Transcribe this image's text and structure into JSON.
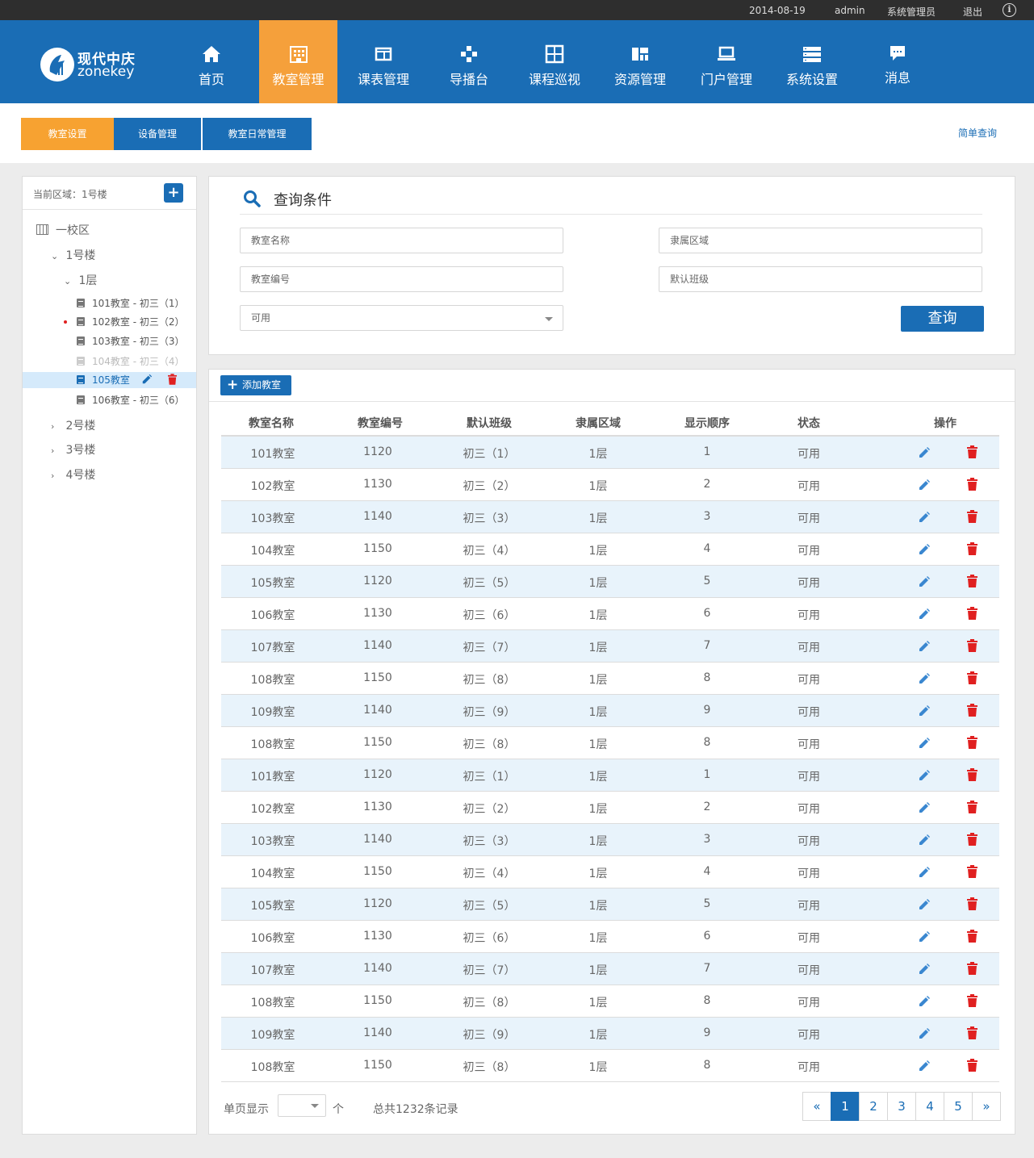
{
  "topbar": {
    "date": "2014-08-19",
    "user": "admin",
    "role": "系统管理员",
    "logout": "退出",
    "info_icon": "info-icon"
  },
  "brand": {
    "cn": "现代中庆",
    "en": "zonekey"
  },
  "colors": {
    "primary": "#1a6db5",
    "accent": "#f5a03b",
    "danger": "#e02020",
    "row_alt": "#e8f3fb"
  },
  "nav": [
    {
      "label": "首页",
      "icon": "home-icon",
      "active": false
    },
    {
      "label": "教室管理",
      "icon": "building-icon",
      "active": true
    },
    {
      "label": "课表管理",
      "icon": "schedule-icon",
      "active": false
    },
    {
      "label": "导播台",
      "icon": "gamepad-icon",
      "active": false
    },
    {
      "label": "课程巡视",
      "icon": "grid-icon",
      "active": false
    },
    {
      "label": "资源管理",
      "icon": "dashboard-icon",
      "active": false
    },
    {
      "label": "门户管理",
      "icon": "laptop-icon",
      "active": false
    },
    {
      "label": "系统设置",
      "icon": "list-icon",
      "active": false
    },
    {
      "label": "消息",
      "icon": "message-icon",
      "active": false
    }
  ],
  "subtabs": [
    {
      "label": "教室设置",
      "active": true
    },
    {
      "label": "设备管理",
      "active": false
    },
    {
      "label": "教室日常管理",
      "active": false
    }
  ],
  "simple_query": "简单查询",
  "tree": {
    "current_area": "当前区域：1号楼",
    "add_icon": "plus-icon",
    "root": "一校区",
    "building1": "1号楼",
    "floor1": "1层",
    "rooms": [
      {
        "label": "101教室 - 初三（1）",
        "state": "normal"
      },
      {
        "label": "102教室 - 初三（2）",
        "state": "normal"
      },
      {
        "label": "103教室 - 初三（3）",
        "state": "normal"
      },
      {
        "label": "104教室 - 初三（4）",
        "state": "disabled"
      },
      {
        "label": "105教室",
        "state": "selected"
      },
      {
        "label": "106教室 - 初三（6）",
        "state": "normal"
      }
    ],
    "others": [
      "2号楼",
      "3号楼",
      "4号楼"
    ]
  },
  "query": {
    "title": "查询条件",
    "room_name_placeholder": "教室名称",
    "area_placeholder": "隶属区域",
    "room_no_placeholder": "教室编号",
    "default_class_placeholder": "默认班级",
    "status_value": "可用",
    "submit": "查询"
  },
  "table": {
    "add_button": "添加教室",
    "headers": [
      "教室名称",
      "教室编号",
      "默认班级",
      "隶属区域",
      "显示顺序",
      "状态",
      "操作"
    ],
    "rows": [
      [
        "101教室",
        "1120",
        "初三（1）",
        "1层",
        "1",
        "可用"
      ],
      [
        "102教室",
        "1130",
        "初三（2）",
        "1层",
        "2",
        "可用"
      ],
      [
        "103教室",
        "1140",
        "初三（3）",
        "1层",
        "3",
        "可用"
      ],
      [
        "104教室",
        "1150",
        "初三（4）",
        "1层",
        "4",
        "可用"
      ],
      [
        "105教室",
        "1120",
        "初三（5）",
        "1层",
        "5",
        "可用"
      ],
      [
        "106教室",
        "1130",
        "初三（6）",
        "1层",
        "6",
        "可用"
      ],
      [
        "107教室",
        "1140",
        "初三（7）",
        "1层",
        "7",
        "可用"
      ],
      [
        "108教室",
        "1150",
        "初三（8）",
        "1层",
        "8",
        "可用"
      ],
      [
        "109教室",
        "1140",
        "初三（9）",
        "1层",
        "9",
        "可用"
      ],
      [
        "108教室",
        "1150",
        "初三（8）",
        "1层",
        "8",
        "可用"
      ],
      [
        "101教室",
        "1120",
        "初三（1）",
        "1层",
        "1",
        "可用"
      ],
      [
        "102教室",
        "1130",
        "初三（2）",
        "1层",
        "2",
        "可用"
      ],
      [
        "103教室",
        "1140",
        "初三（3）",
        "1层",
        "3",
        "可用"
      ],
      [
        "104教室",
        "1150",
        "初三（4）",
        "1层",
        "4",
        "可用"
      ],
      [
        "105教室",
        "1120",
        "初三（5）",
        "1层",
        "5",
        "可用"
      ],
      [
        "106教室",
        "1130",
        "初三（6）",
        "1层",
        "6",
        "可用"
      ],
      [
        "107教室",
        "1140",
        "初三（7）",
        "1层",
        "7",
        "可用"
      ],
      [
        "108教室",
        "1150",
        "初三（8）",
        "1层",
        "8",
        "可用"
      ],
      [
        "109教室",
        "1140",
        "初三（9）",
        "1层",
        "9",
        "可用"
      ],
      [
        "108教室",
        "1150",
        "初三（8）",
        "1层",
        "8",
        "可用"
      ]
    ]
  },
  "pager": {
    "per_page_label": "单页显示",
    "per_page_unit": "个",
    "total": "总共1232条记录",
    "prev": "«",
    "next": "»",
    "pages": [
      "1",
      "2",
      "3",
      "4",
      "5"
    ],
    "current": "1"
  }
}
